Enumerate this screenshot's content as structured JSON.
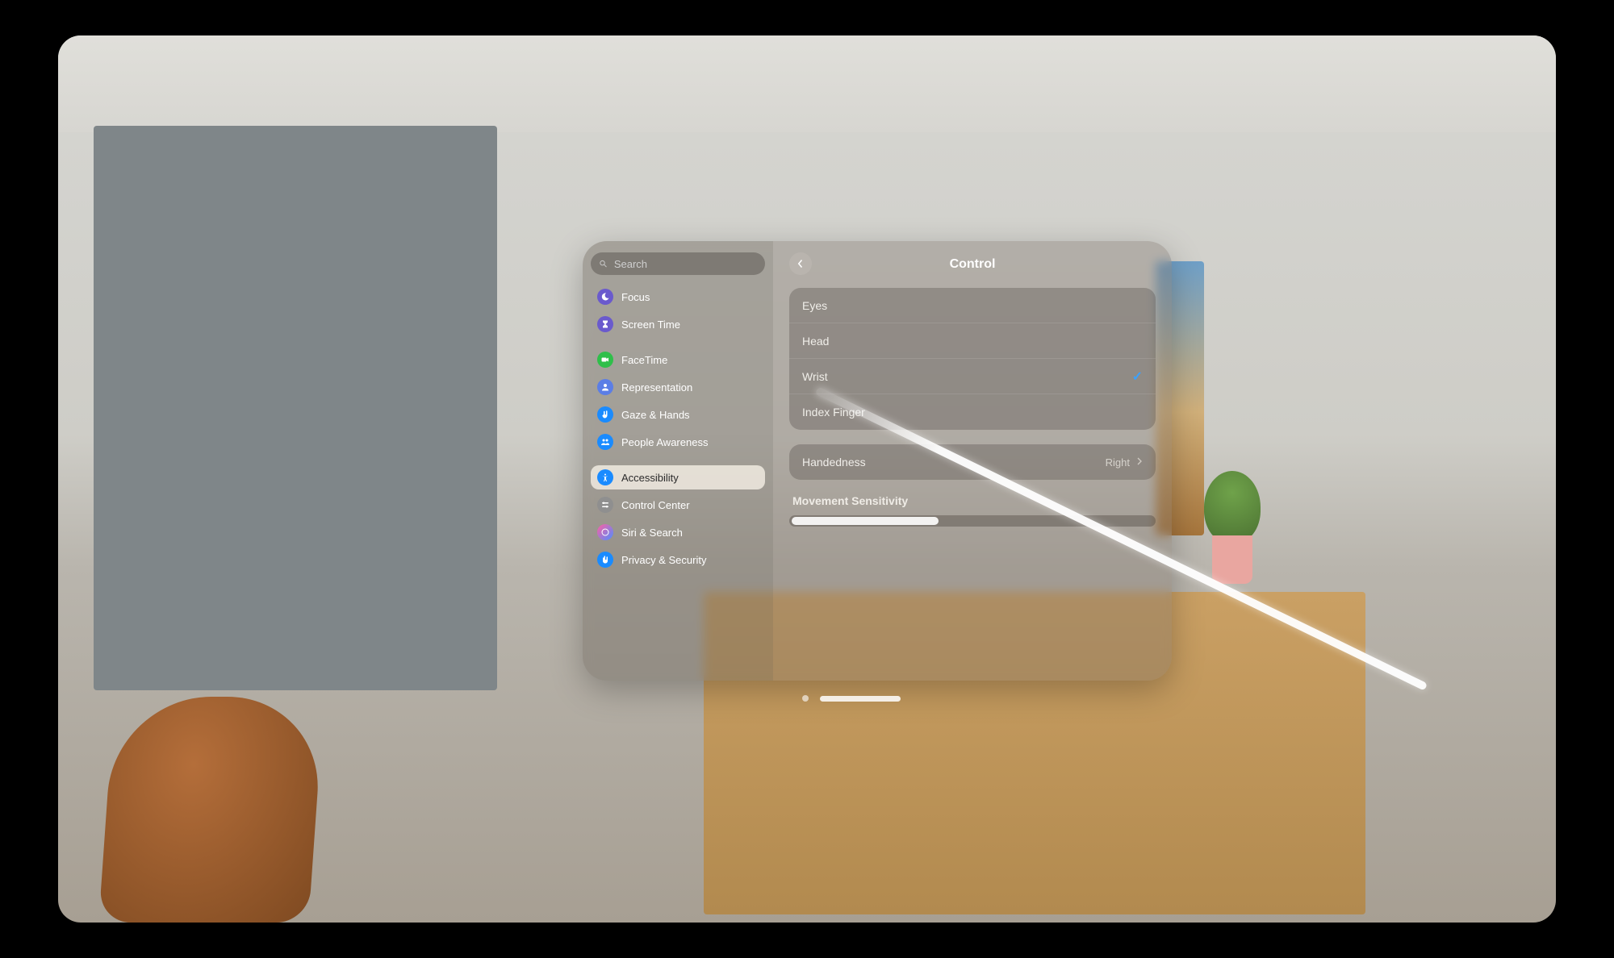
{
  "search": {
    "placeholder": "Search"
  },
  "sidebar": {
    "items": [
      {
        "label": "Focus",
        "color": "#6a5acd"
      },
      {
        "label": "Screen Time",
        "color": "#6a5acd"
      },
      {
        "label": "FaceTime",
        "color": "#2fbf4a"
      },
      {
        "label": "Representation",
        "color": "#5b7ee6"
      },
      {
        "label": "Gaze & Hands",
        "color": "#1a8bff"
      },
      {
        "label": "People Awareness",
        "color": "#1a8bff"
      },
      {
        "label": "Accessibility",
        "color": "#1a8bff"
      },
      {
        "label": "Control Center",
        "color": "#8f8f8f"
      },
      {
        "label": "Siri & Search",
        "color": "#c04f8f"
      },
      {
        "label": "Privacy & Security",
        "color": "#1a8bff"
      }
    ],
    "selected_index": 6
  },
  "main": {
    "title": "Control",
    "options": [
      {
        "label": "Eyes",
        "selected": false
      },
      {
        "label": "Head",
        "selected": false
      },
      {
        "label": "Wrist",
        "selected": true
      },
      {
        "label": "Index Finger",
        "selected": false
      }
    ],
    "handedness": {
      "label": "Handedness",
      "value": "Right"
    },
    "sensitivity": {
      "label": "Movement Sensitivity",
      "percent": 40
    }
  },
  "icons": {
    "focus": "moon",
    "screen_time": "hourglass",
    "facetime": "video",
    "representation": "person",
    "gaze": "hand",
    "people": "people",
    "accessibility": "accessibility",
    "control_center": "switches",
    "siri": "siri",
    "privacy": "hand-raise"
  }
}
